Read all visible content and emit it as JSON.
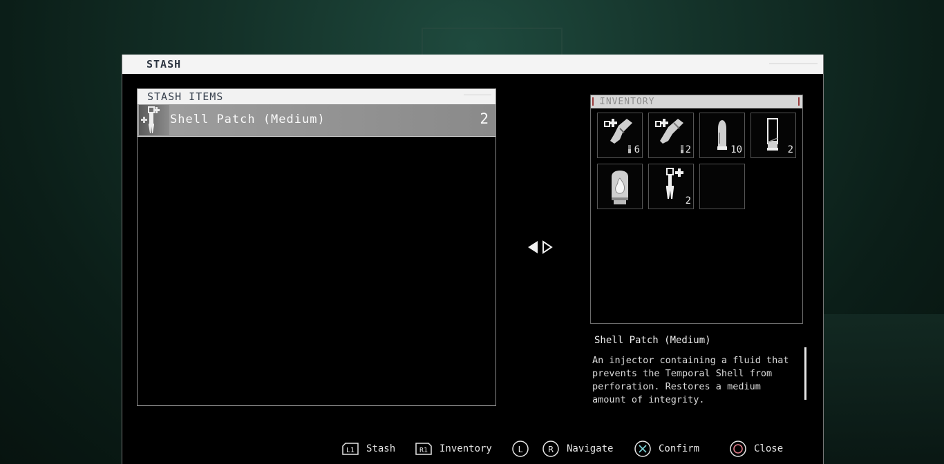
{
  "window": {
    "title": "STASH"
  },
  "stash": {
    "header": "STASH ITEMS",
    "items": [
      {
        "name": "Shell Patch (Medium)",
        "qty": "2",
        "icon": "shell-patch-icon"
      }
    ]
  },
  "inventory": {
    "header": "INVENTORY",
    "slots": [
      {
        "icon": "rifle-icon",
        "qty": "6"
      },
      {
        "icon": "shotgun-icon",
        "qty": "2"
      },
      {
        "icon": "bullet-icon",
        "qty": "10"
      },
      {
        "icon": "shotgun-shell-icon",
        "qty": "2"
      },
      {
        "icon": "fire-canister-icon",
        "qty": ""
      },
      {
        "icon": "shell-patch-icon",
        "qty": "2"
      },
      {
        "icon": "empty-slot",
        "qty": ""
      }
    ]
  },
  "description": {
    "title": "Shell Patch (Medium)",
    "text": "An injector containing a fluid that prevents the Temporal Shell from perforation. Restores a medium amount of integrity."
  },
  "footer": {
    "stash": {
      "button": "L1",
      "label": "Stash"
    },
    "inventory": {
      "button": "R1",
      "label": "Inventory"
    },
    "navigate": {
      "button_left": "L",
      "button_right": "R",
      "label": "Navigate"
    },
    "confirm": {
      "label": "Confirm"
    },
    "close": {
      "label": "Close"
    }
  },
  "colors": {
    "accent_confirm": "#7fd4d8",
    "accent_close": "#e07a86"
  }
}
